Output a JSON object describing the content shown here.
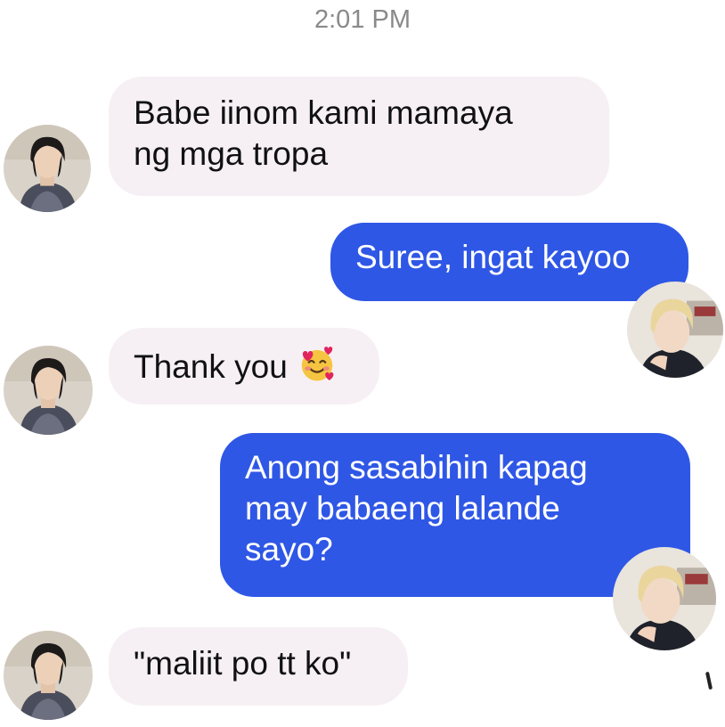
{
  "conversation": {
    "timestamp": "2:01 PM",
    "messages": [
      {
        "sender": "them",
        "text": "Babe iinom kami mamaya\nng mga tropa"
      },
      {
        "sender": "me",
        "text": "Suree, ingat kayoo"
      },
      {
        "sender": "them",
        "text": "Thank you"
      },
      {
        "sender": "me",
        "text": "Anong sasabihin kapag\nmay babaeng lalande\nsayo?"
      },
      {
        "sender": "them",
        "text": "\"maliit po tt ko\""
      }
    ],
    "emoji": "smiling-face-with-hearts-icon"
  },
  "colors": {
    "incoming_bubble": "#f6f0f4",
    "outgoing_bubble": "#2f57e6",
    "timestamp": "#8a8a8a"
  }
}
